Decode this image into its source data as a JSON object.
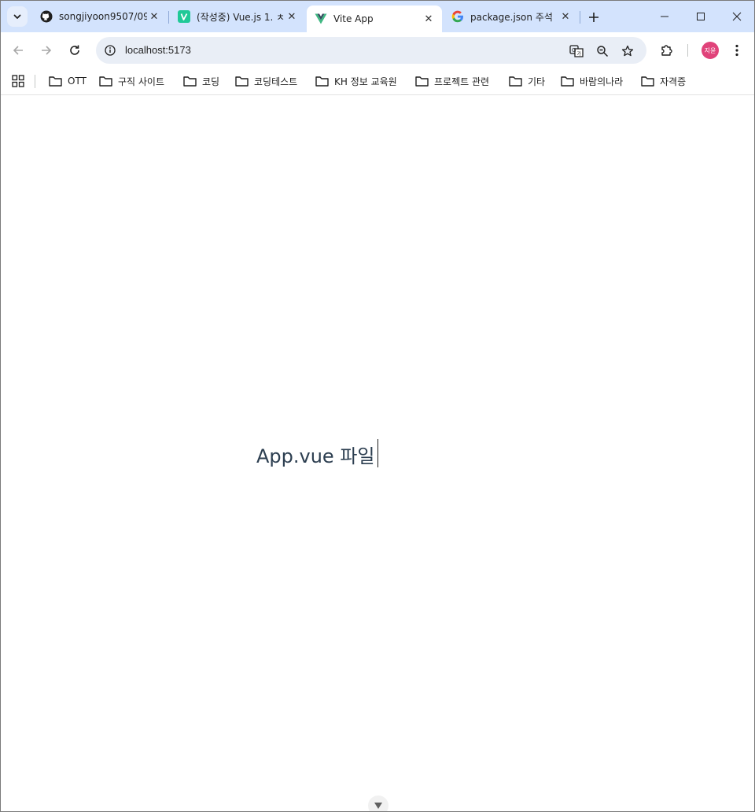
{
  "tabs": [
    {
      "title": "songjiyoon9507/09",
      "favicon": "github-icon",
      "active": false
    },
    {
      "title": "(작성중) Vue.js 1. ㅊ",
      "favicon": "velog-icon",
      "active": false
    },
    {
      "title": "Vite App",
      "favicon": "vue-icon",
      "active": true
    },
    {
      "title": "package.json 주석",
      "favicon": "google-icon",
      "active": false
    }
  ],
  "toolbar": {
    "url": "localhost:5173",
    "profile_label": "지윤"
  },
  "bookmarks": [
    {
      "label": "OTT"
    },
    {
      "label": "구직 사이트"
    },
    {
      "label": "코딩"
    },
    {
      "label": "코딩테스트"
    },
    {
      "label": "KH 정보 교육원"
    },
    {
      "label": "프로젝트 관련"
    },
    {
      "label": "기타"
    },
    {
      "label": "바람의나라"
    },
    {
      "label": "자격증"
    }
  ],
  "page": {
    "main_text": "App.vue 파일"
  },
  "colors": {
    "tabstrip": "#d3e3fd",
    "omnibox": "#e9eef6",
    "text": "#2c3e50",
    "avatar": "#e0437a"
  }
}
